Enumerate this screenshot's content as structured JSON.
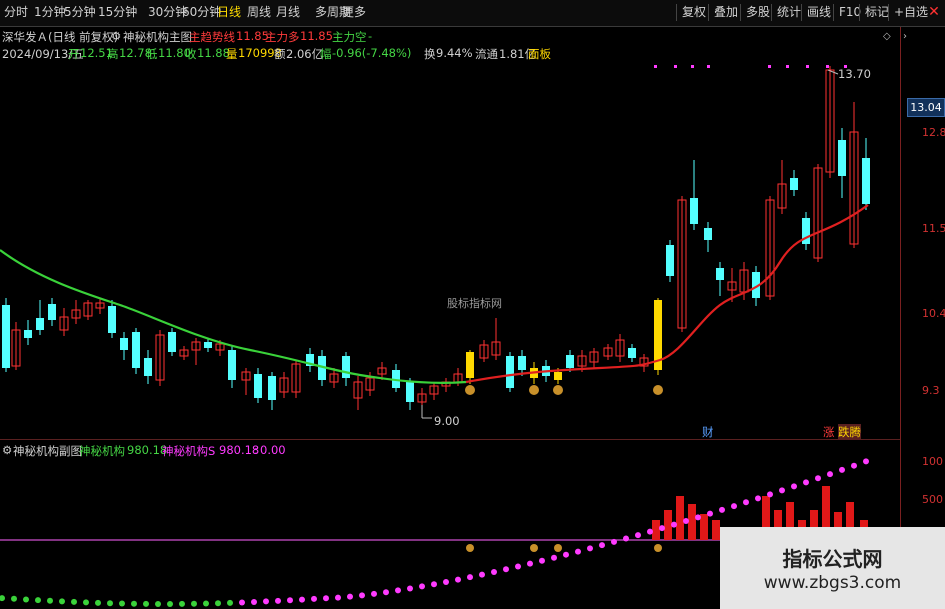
{
  "toolbar": {
    "period_tabs": [
      "分时",
      "1分钟",
      "5分钟",
      "15分钟",
      "30分钟",
      "60分钟",
      "日线",
      "周线",
      "月线",
      "多周期",
      "更多"
    ],
    "active_tab": "日线",
    "right_buttons": [
      "复权",
      "叠加",
      "多股",
      "统计",
      "画线",
      "F10",
      "标记",
      "+自选"
    ],
    "close_icon": "close-icon"
  },
  "header": {
    "stock_name": "深华发Ａ(日线 前复权)",
    "indicator_name": "神秘机构主图",
    "main_trend_label": "主趋势线",
    "main_trend_value": "11.85",
    "main_long_label": "主力多",
    "main_long_value": "11.85",
    "main_short_label": "主力空",
    "main_short_value": "-",
    "date": "2024/09/13/五",
    "open_label": "开",
    "open": "12.51",
    "high_label": "高",
    "high": "12.78",
    "low_label": "低",
    "low": "11.80",
    "close_label": "收",
    "close": "11.88",
    "volume_label": "量",
    "volume": "170998",
    "amount_label": "额",
    "amount": "2.06亿",
    "change_label": "幅",
    "change": "-0.96(-7.48%)",
    "turnover_label": "换",
    "turnover": "9.44%",
    "float_label": "流通",
    "float_cap": "1.81亿",
    "panel_label": "面板"
  },
  "price_axis": {
    "ticks": [
      "12.8",
      "11.5",
      "10.4",
      "9.3"
    ],
    "last_price": "13.04"
  },
  "annotations": {
    "high_marker": "13.70",
    "low_marker": "9.00",
    "center_watermark": "股标指标网",
    "cai_label": "财",
    "zhang_label": "涨",
    "die_teng_label": "跌腾"
  },
  "sub_panel": {
    "title": "神秘机构副图",
    "line1_label": "神秘机构",
    "line1_value": "980.18",
    "line2_label": "神秘机构S",
    "line2_value": "980.18",
    "line3_value": "0.00",
    "axis_ticks": [
      "100",
      "500"
    ]
  },
  "watermark": {
    "title": "指标公式网",
    "url": "www.zbgs3.com"
  },
  "colors": {
    "up": "#ff3232",
    "down": "#54ffff",
    "ma_green": "#3ad23a",
    "ma_red": "#e02020",
    "signal_yellow": "#ffd900",
    "magenta": "#ff3bff"
  }
}
